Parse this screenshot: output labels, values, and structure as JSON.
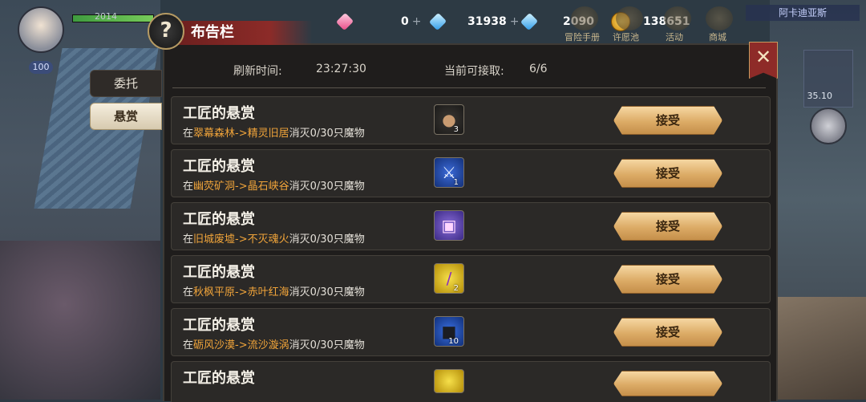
{
  "hud": {
    "hp_value": "2014",
    "level": "100",
    "currencies": [
      {
        "icon": "pink-gem-icon",
        "value": "0"
      },
      {
        "icon": "blue-gem-icon",
        "value": "31938"
      },
      {
        "icon": "locked-blue-gem-icon",
        "value": "2090"
      },
      {
        "icon": "gold-coin-icon",
        "value": "138651"
      }
    ],
    "menu": [
      "冒险手册",
      "许愿池",
      "活动",
      "商城"
    ],
    "location": "阿卡迪亚斯",
    "coord": "35.10"
  },
  "tabs": {
    "weituo": "委托",
    "xuanshang": "悬赏"
  },
  "panel": {
    "title": "布告栏",
    "help_glyph": "?",
    "close_glyph": "✕",
    "refresh_label": "刷新时间:",
    "refresh_time": "23:27:30",
    "available_label": "当前可接取:",
    "available_value": "6/6"
  },
  "bounties": [
    {
      "title": "工匠的悬赏",
      "prefix": "在",
      "route": "翠幕森林->精灵旧居",
      "task": "消灭0/30只魔物",
      "reward_icon": "bag-icon",
      "reward_count": "3",
      "accept": "接受"
    },
    {
      "title": "工匠的悬赏",
      "prefix": "在",
      "route": "幽荧矿洞->晶石峡谷",
      "task": "消灭0/30只魔物",
      "reward_icon": "sword-icon",
      "reward_count": "1",
      "accept": "接受"
    },
    {
      "title": "工匠的悬赏",
      "prefix": "在",
      "route": "旧城废墟->不灭魂火",
      "task": "消灭0/30只魔物",
      "reward_icon": "gift-box-icon",
      "reward_count": "",
      "accept": "接受"
    },
    {
      "title": "工匠的悬赏",
      "prefix": "在",
      "route": "秋枫平原->赤叶红海",
      "task": "消灭0/30只魔物",
      "reward_icon": "scroll-icon",
      "reward_count": "2",
      "accept": "接受"
    },
    {
      "title": "工匠的悬赏",
      "prefix": "在",
      "route": "砺风沙漠->流沙漩涡",
      "task": "消灭0/30只魔物",
      "reward_icon": "cube-icon",
      "reward_count": "10",
      "accept": "接受"
    },
    {
      "title": "工匠的悬赏",
      "prefix": "",
      "route": "",
      "task": "",
      "reward_icon": "item-icon",
      "reward_count": "",
      "accept": ""
    }
  ]
}
